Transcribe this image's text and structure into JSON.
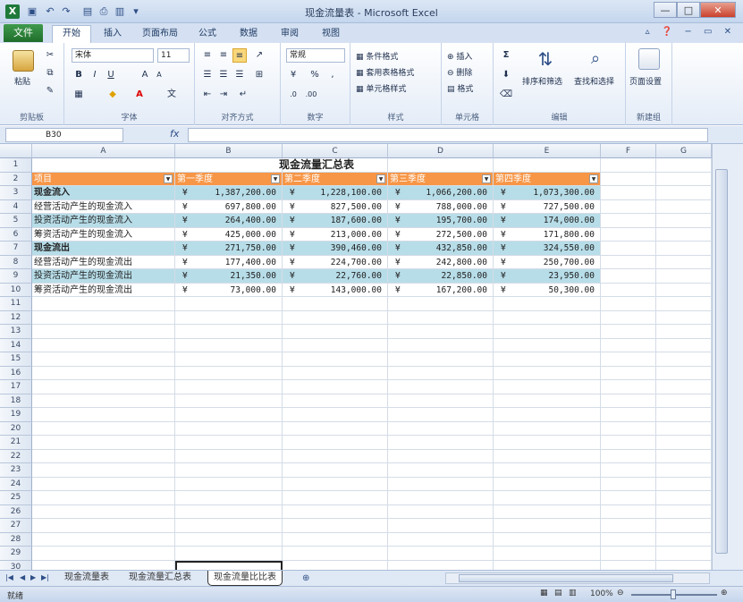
{
  "window": {
    "title": "现金流量表 - Microsoft Excel",
    "app_icon": "X",
    "quick_access": [
      "save-icon",
      "undo-icon",
      "redo-icon",
      "open-icon",
      "print-icon",
      "chart-icon",
      "customize-icon"
    ],
    "buttons": {
      "minimize": "—",
      "restore": "□",
      "close": "✕"
    }
  },
  "ribbon_tabs": {
    "file": "文件",
    "tabs": [
      "开始",
      "插入",
      "页面布局",
      "公式",
      "数据",
      "审阅",
      "视图"
    ],
    "active": "开始"
  },
  "ribbon": {
    "clipboard": {
      "label": "剪贴板",
      "paste": "粘贴"
    },
    "font": {
      "label": "字体",
      "name": "宋体",
      "size": "11",
      "bold": "B",
      "italic": "I",
      "underline": "U",
      "grow": "A",
      "shrink": "A",
      "wen": "文"
    },
    "align": {
      "label": "对齐方式"
    },
    "number": {
      "label": "数字",
      "format": "常规",
      "percent": "%",
      "comma": ","
    },
    "styles": {
      "label": "样式",
      "cond": "条件格式",
      "table": "套用表格格式",
      "cell": "单元格样式"
    },
    "cells": {
      "label": "单元格",
      "insert": "插入",
      "delete": "删除",
      "format": "格式"
    },
    "edit": {
      "label": "编辑",
      "sigma": "Σ",
      "sort": "排序和筛选",
      "find": "查找和选择"
    },
    "newgroup": {
      "label": "新建组",
      "page": "页面设置"
    }
  },
  "formula_bar": {
    "name_box": "B30",
    "fx": "fx",
    "value": ""
  },
  "columns": [
    "A",
    "B",
    "C",
    "D",
    "E",
    "F",
    "G"
  ],
  "sheet": {
    "title": "现金流量汇总表",
    "headers": [
      "项目",
      "第一季度",
      "第二季度",
      "第三季度",
      "第四季度"
    ],
    "currency": "¥",
    "rows": [
      {
        "label": "现金流入",
        "bold": true,
        "values": [
          "1,387,200.00",
          "1,228,100.00",
          "1,066,200.00",
          "1,073,300.00"
        ]
      },
      {
        "label": "经营活动产生的现金流入",
        "bold": false,
        "values": [
          "697,800.00",
          "827,500.00",
          "788,000.00",
          "727,500.00"
        ]
      },
      {
        "label": "投资活动产生的现金流入",
        "bold": false,
        "values": [
          "264,400.00",
          "187,600.00",
          "195,700.00",
          "174,000.00"
        ]
      },
      {
        "label": "筹资活动产生的现金流入",
        "bold": false,
        "values": [
          "425,000.00",
          "213,000.00",
          "272,500.00",
          "171,800.00"
        ]
      },
      {
        "label": "现金流出",
        "bold": true,
        "values": [
          "271,750.00",
          "390,460.00",
          "432,850.00",
          "324,550.00"
        ]
      },
      {
        "label": "经营活动产生的现金流出",
        "bold": false,
        "values": [
          "177,400.00",
          "224,700.00",
          "242,800.00",
          "250,700.00"
        ]
      },
      {
        "label": "投资活动产生的现金流出",
        "bold": false,
        "values": [
          "21,350.00",
          "22,760.00",
          "22,850.00",
          "23,950.00"
        ]
      },
      {
        "label": "筹资活动产生的现金流出",
        "bold": false,
        "values": [
          "73,000.00",
          "143,000.00",
          "167,200.00",
          "50,300.00"
        ]
      }
    ],
    "row_count": 30
  },
  "sheet_tabs": [
    "现金流量表",
    "现金流量汇总表",
    "现金流量比比表"
  ],
  "active_sheet": "现金流量比比表",
  "status": {
    "mode": "就绪",
    "zoom": "100%"
  }
}
